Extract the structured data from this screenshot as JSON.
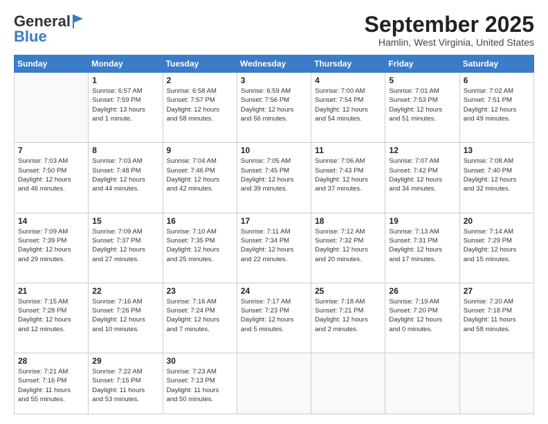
{
  "header": {
    "logo_general": "General",
    "logo_blue": "Blue",
    "month_title": "September 2025",
    "location": "Hamlin, West Virginia, United States"
  },
  "days_of_week": [
    "Sunday",
    "Monday",
    "Tuesday",
    "Wednesday",
    "Thursday",
    "Friday",
    "Saturday"
  ],
  "weeks": [
    [
      {
        "day": "",
        "info": ""
      },
      {
        "day": "1",
        "info": "Sunrise: 6:57 AM\nSunset: 7:59 PM\nDaylight: 13 hours\nand 1 minute."
      },
      {
        "day": "2",
        "info": "Sunrise: 6:58 AM\nSunset: 7:57 PM\nDaylight: 12 hours\nand 58 minutes."
      },
      {
        "day": "3",
        "info": "Sunrise: 6:59 AM\nSunset: 7:56 PM\nDaylight: 12 hours\nand 56 minutes."
      },
      {
        "day": "4",
        "info": "Sunrise: 7:00 AM\nSunset: 7:54 PM\nDaylight: 12 hours\nand 54 minutes."
      },
      {
        "day": "5",
        "info": "Sunrise: 7:01 AM\nSunset: 7:53 PM\nDaylight: 12 hours\nand 51 minutes."
      },
      {
        "day": "6",
        "info": "Sunrise: 7:02 AM\nSunset: 7:51 PM\nDaylight: 12 hours\nand 49 minutes."
      }
    ],
    [
      {
        "day": "7",
        "info": "Sunrise: 7:03 AM\nSunset: 7:50 PM\nDaylight: 12 hours\nand 46 minutes."
      },
      {
        "day": "8",
        "info": "Sunrise: 7:03 AM\nSunset: 7:48 PM\nDaylight: 12 hours\nand 44 minutes."
      },
      {
        "day": "9",
        "info": "Sunrise: 7:04 AM\nSunset: 7:46 PM\nDaylight: 12 hours\nand 42 minutes."
      },
      {
        "day": "10",
        "info": "Sunrise: 7:05 AM\nSunset: 7:45 PM\nDaylight: 12 hours\nand 39 minutes."
      },
      {
        "day": "11",
        "info": "Sunrise: 7:06 AM\nSunset: 7:43 PM\nDaylight: 12 hours\nand 37 minutes."
      },
      {
        "day": "12",
        "info": "Sunrise: 7:07 AM\nSunset: 7:42 PM\nDaylight: 12 hours\nand 34 minutes."
      },
      {
        "day": "13",
        "info": "Sunrise: 7:08 AM\nSunset: 7:40 PM\nDaylight: 12 hours\nand 32 minutes."
      }
    ],
    [
      {
        "day": "14",
        "info": "Sunrise: 7:09 AM\nSunset: 7:39 PM\nDaylight: 12 hours\nand 29 minutes."
      },
      {
        "day": "15",
        "info": "Sunrise: 7:09 AM\nSunset: 7:37 PM\nDaylight: 12 hours\nand 27 minutes."
      },
      {
        "day": "16",
        "info": "Sunrise: 7:10 AM\nSunset: 7:35 PM\nDaylight: 12 hours\nand 25 minutes."
      },
      {
        "day": "17",
        "info": "Sunrise: 7:11 AM\nSunset: 7:34 PM\nDaylight: 12 hours\nand 22 minutes."
      },
      {
        "day": "18",
        "info": "Sunrise: 7:12 AM\nSunset: 7:32 PM\nDaylight: 12 hours\nand 20 minutes."
      },
      {
        "day": "19",
        "info": "Sunrise: 7:13 AM\nSunset: 7:31 PM\nDaylight: 12 hours\nand 17 minutes."
      },
      {
        "day": "20",
        "info": "Sunrise: 7:14 AM\nSunset: 7:29 PM\nDaylight: 12 hours\nand 15 minutes."
      }
    ],
    [
      {
        "day": "21",
        "info": "Sunrise: 7:15 AM\nSunset: 7:28 PM\nDaylight: 12 hours\nand 12 minutes."
      },
      {
        "day": "22",
        "info": "Sunrise: 7:16 AM\nSunset: 7:26 PM\nDaylight: 12 hours\nand 10 minutes."
      },
      {
        "day": "23",
        "info": "Sunrise: 7:16 AM\nSunset: 7:24 PM\nDaylight: 12 hours\nand 7 minutes."
      },
      {
        "day": "24",
        "info": "Sunrise: 7:17 AM\nSunset: 7:23 PM\nDaylight: 12 hours\nand 5 minutes."
      },
      {
        "day": "25",
        "info": "Sunrise: 7:18 AM\nSunset: 7:21 PM\nDaylight: 12 hours\nand 2 minutes."
      },
      {
        "day": "26",
        "info": "Sunrise: 7:19 AM\nSunset: 7:20 PM\nDaylight: 12 hours\nand 0 minutes."
      },
      {
        "day": "27",
        "info": "Sunrise: 7:20 AM\nSunset: 7:18 PM\nDaylight: 11 hours\nand 58 minutes."
      }
    ],
    [
      {
        "day": "28",
        "info": "Sunrise: 7:21 AM\nSunset: 7:16 PM\nDaylight: 11 hours\nand 55 minutes."
      },
      {
        "day": "29",
        "info": "Sunrise: 7:22 AM\nSunset: 7:15 PM\nDaylight: 11 hours\nand 53 minutes."
      },
      {
        "day": "30",
        "info": "Sunrise: 7:23 AM\nSunset: 7:13 PM\nDaylight: 11 hours\nand 50 minutes."
      },
      {
        "day": "",
        "info": ""
      },
      {
        "day": "",
        "info": ""
      },
      {
        "day": "",
        "info": ""
      },
      {
        "day": "",
        "info": ""
      }
    ]
  ]
}
